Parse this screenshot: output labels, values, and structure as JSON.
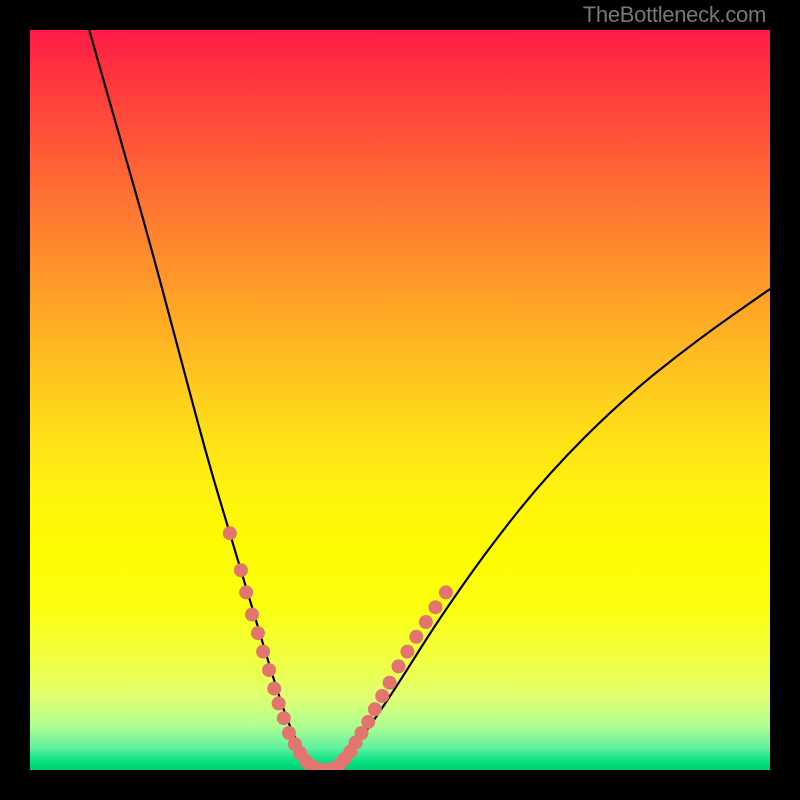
{
  "watermark_text": "TheBottleneck.com",
  "colors": {
    "frame": "#000000",
    "curve": "#000000",
    "dots": "#e2766f",
    "gradient_top": "#ff1a49",
    "gradient_bottom": "#00d070"
  },
  "chart_data": {
    "type": "line",
    "title": "",
    "xlabel": "",
    "ylabel": "",
    "xlim": [
      0,
      100
    ],
    "ylim": [
      0,
      100
    ],
    "grid": false,
    "legend": false,
    "curve_percent": [
      {
        "x": 8,
        "y": 100
      },
      {
        "x": 12,
        "y": 86
      },
      {
        "x": 16,
        "y": 72
      },
      {
        "x": 20,
        "y": 57
      },
      {
        "x": 24,
        "y": 42
      },
      {
        "x": 27,
        "y": 32
      },
      {
        "x": 30,
        "y": 22
      },
      {
        "x": 33,
        "y": 12
      },
      {
        "x": 35,
        "y": 6
      },
      {
        "x": 37,
        "y": 2
      },
      {
        "x": 39,
        "y": 0
      },
      {
        "x": 41,
        "y": 0
      },
      {
        "x": 43,
        "y": 2
      },
      {
        "x": 46,
        "y": 6
      },
      {
        "x": 50,
        "y": 12
      },
      {
        "x": 55,
        "y": 20
      },
      {
        "x": 62,
        "y": 30
      },
      {
        "x": 70,
        "y": 40
      },
      {
        "x": 80,
        "y": 50
      },
      {
        "x": 90,
        "y": 58
      },
      {
        "x": 100,
        "y": 65
      }
    ],
    "dots_percent": [
      {
        "x": 27.0,
        "y": 32.0
      },
      {
        "x": 28.5,
        "y": 27.0
      },
      {
        "x": 29.2,
        "y": 24.0
      },
      {
        "x": 30.0,
        "y": 21.0
      },
      {
        "x": 30.8,
        "y": 18.5
      },
      {
        "x": 31.5,
        "y": 16.0
      },
      {
        "x": 32.3,
        "y": 13.5
      },
      {
        "x": 33.0,
        "y": 11.0
      },
      {
        "x": 33.6,
        "y": 9.0
      },
      {
        "x": 34.3,
        "y": 7.0
      },
      {
        "x": 35.0,
        "y": 5.0
      },
      {
        "x": 35.8,
        "y": 3.5
      },
      {
        "x": 36.5,
        "y": 2.3
      },
      {
        "x": 37.3,
        "y": 1.2
      },
      {
        "x": 38.0,
        "y": 0.5
      },
      {
        "x": 38.8,
        "y": 0.2
      },
      {
        "x": 39.5,
        "y": 0.0
      },
      {
        "x": 40.3,
        "y": 0.0
      },
      {
        "x": 41.0,
        "y": 0.2
      },
      {
        "x": 41.8,
        "y": 0.7
      },
      {
        "x": 42.5,
        "y": 1.5
      },
      {
        "x": 43.3,
        "y": 2.5
      },
      {
        "x": 44.0,
        "y": 3.7
      },
      {
        "x": 44.8,
        "y": 5.0
      },
      {
        "x": 45.7,
        "y": 6.5
      },
      {
        "x": 46.6,
        "y": 8.2
      },
      {
        "x": 47.6,
        "y": 10.0
      },
      {
        "x": 48.6,
        "y": 11.8
      },
      {
        "x": 49.8,
        "y": 14.0
      },
      {
        "x": 51.0,
        "y": 16.0
      },
      {
        "x": 52.2,
        "y": 18.0
      },
      {
        "x": 53.5,
        "y": 20.0
      },
      {
        "x": 54.8,
        "y": 22.0
      },
      {
        "x": 56.2,
        "y": 24.0
      }
    ]
  }
}
